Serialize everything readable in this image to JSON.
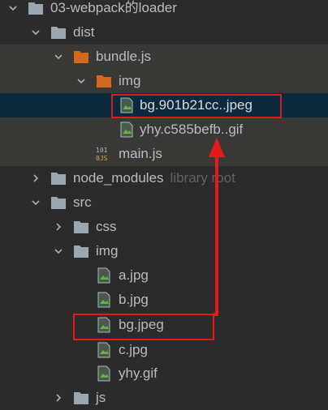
{
  "tree": {
    "root": {
      "label": "03-webpack的loader"
    },
    "dist": {
      "label": "dist"
    },
    "bundle": {
      "label": "bundle.js"
    },
    "dist_img": {
      "label": "img"
    },
    "bg_hashed": {
      "label": "bg.901b21cc..jpeg"
    },
    "yhy_hashed": {
      "label": "yhy.c585befb..gif"
    },
    "main": {
      "label": "main.js",
      "icon_text_top": "101",
      "icon_text_bottom": "0JS"
    },
    "node_modules": {
      "label": "node_modules",
      "hint": "library root"
    },
    "src": {
      "label": "src"
    },
    "css": {
      "label": "css"
    },
    "src_img": {
      "label": "img"
    },
    "a": {
      "label": "a.jpg"
    },
    "b": {
      "label": "b.jpg"
    },
    "bg": {
      "label": "bg.jpeg"
    },
    "c": {
      "label": "c.jpg"
    },
    "yhy": {
      "label": "yhy.gif"
    },
    "js": {
      "label": "js"
    }
  },
  "colors": {
    "background": "#2b2b2b",
    "excluded_row": "#3a3835",
    "selected_row": "#0d293e",
    "folder_gray": "#9aa7b0",
    "folder_orange": "#d2691e",
    "annotation_red": "#e51a1a"
  },
  "annotations": {
    "arrow": "arrow-icon"
  }
}
